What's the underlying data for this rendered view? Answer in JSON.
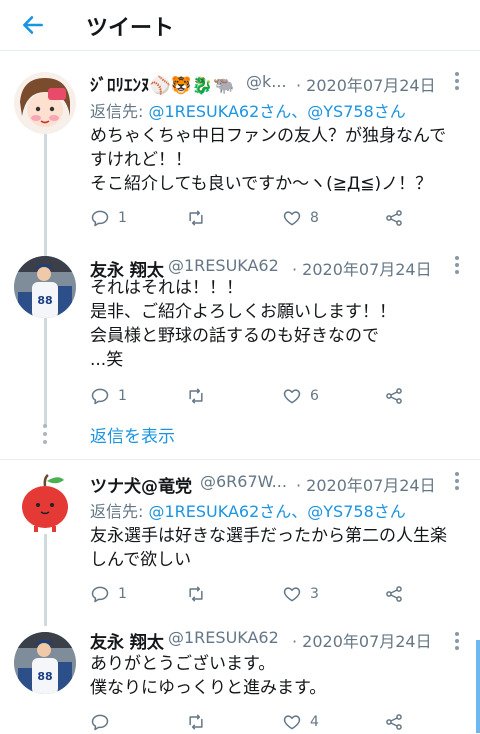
{
  "header": {
    "title": "ツイート"
  },
  "tweets": [
    {
      "name": "ｼﾞﾛﾘｴﾝﾇ⚾🐯🐉🐃",
      "handle": "@k...",
      "date": "· 2020年07月24日",
      "reply_prefix": "返信先: ",
      "reply_users": "@1RESUKA62さん、@YS758さん",
      "text": "めちゃくちゃ中日ファンの友人？が独身なんで\nすけれど！！\nそこ紹介しても良いですか〜ヽ(≧Д≦)ノ！？",
      "replies": "1",
      "retweets": "",
      "likes": "8"
    },
    {
      "name": "友永 翔太",
      "handle": "@1RESUKA62",
      "date": "· 2020年07月24日",
      "text": "それはそれは！！！\n是非、ご紹介よろしくお願いします！！\n会員様と野球の話するのも好きなので\n...笑",
      "replies": "1",
      "retweets": "",
      "likes": "6"
    },
    {
      "name": "ツナ犬@竜党",
      "handle": "@6R67W...",
      "date": "· 2020年07月24日",
      "reply_prefix": "返信先: ",
      "reply_users": "@1RESUKA62さん、@YS758さん",
      "text": "友永選手は好きな選手だったから第二の人生楽\nしんで欲しい",
      "replies": "1",
      "retweets": "",
      "likes": "3"
    },
    {
      "name": "友永 翔太",
      "handle": "@1RESUKA62",
      "date": "· 2020年07月24日",
      "text": "ありがとうございます。\n僕なりにゆっくりと進みます。",
      "replies": "",
      "retweets": "",
      "likes": "4"
    }
  ],
  "show_replies": "返信を表示",
  "colors": {
    "accent": "#1b95e0",
    "muted": "#657786",
    "divider": "#e6ecf0"
  }
}
